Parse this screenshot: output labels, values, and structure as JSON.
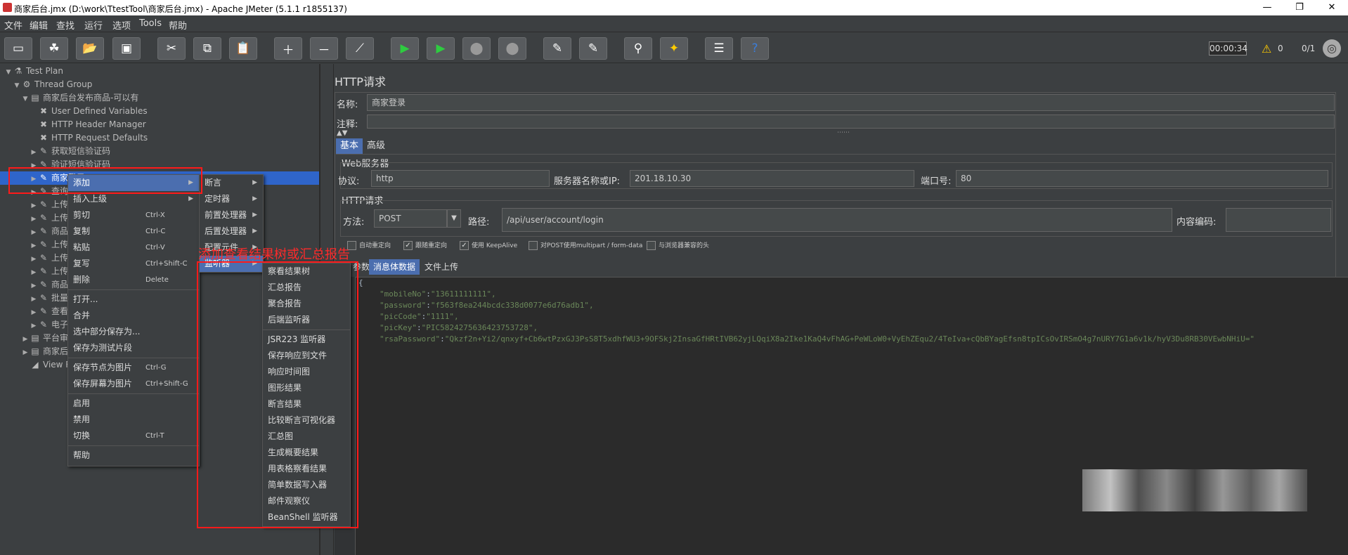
{
  "titlebar": {
    "title": "商家后台.jmx (D:\\work\\TtestTool\\商家后台.jmx) - Apache JMeter (5.1.1 r1855137)",
    "min": "—",
    "max": "❐",
    "close": "✕"
  },
  "menubar": {
    "items": [
      "文件",
      "编辑",
      "查找",
      "运行",
      "选项",
      "Tools",
      "帮助"
    ]
  },
  "toolbar": {
    "timer": "00:00:34",
    "warnings": "0",
    "threads": "0/1",
    "buttons": [
      "new-icon",
      "templates-icon",
      "open-icon",
      "save-icon",
      "cut-icon",
      "copy-icon",
      "paste-icon",
      "expand-icon",
      "collapse-icon",
      "toggle-icon",
      "start-icon",
      "start-no-pause-icon",
      "stop-icon",
      "shutdown-icon",
      "clear-icon",
      "clear-all-icon",
      "search-icon",
      "reset-search-icon",
      "function-helper-icon",
      "help-icon"
    ]
  },
  "tree": {
    "items": [
      {
        "label": "Test Plan",
        "indent": 0,
        "arrow": "▼",
        "icon": "⚗"
      },
      {
        "label": "Thread Group",
        "indent": 1,
        "arrow": "▼",
        "icon": "⚙"
      },
      {
        "label": "商家后台发布商品-可以有",
        "indent": 2,
        "arrow": "▼",
        "icon": "▤"
      },
      {
        "label": "User Defined Variables",
        "indent": 3,
        "arrow": "",
        "icon": "✖"
      },
      {
        "label": "HTTP Header Manager",
        "indent": 3,
        "arrow": "",
        "icon": "✖"
      },
      {
        "label": "HTTP Request Defaults",
        "indent": 3,
        "arrow": "",
        "icon": "✖"
      },
      {
        "label": "获取短信验证码",
        "indent": 3,
        "arrow": "▶",
        "icon": "✎"
      },
      {
        "label": "验证短信验证码",
        "indent": 3,
        "arrow": "▶",
        "icon": "✎"
      },
      {
        "label": "商家登录",
        "indent": 3,
        "arrow": "▶",
        "icon": "✎",
        "selected": true
      },
      {
        "label": "查询店",
        "indent": 3,
        "arrow": "▶",
        "icon": "✎"
      },
      {
        "label": "上传商",
        "indent": 3,
        "arrow": "▶",
        "icon": "✎"
      },
      {
        "label": "上传商",
        "indent": 3,
        "arrow": "▶",
        "icon": "✎"
      },
      {
        "label": "商品发",
        "indent": 3,
        "arrow": "▶",
        "icon": "✎"
      },
      {
        "label": "上传商",
        "indent": 3,
        "arrow": "▶",
        "icon": "✎"
      },
      {
        "label": "上传商",
        "indent": 3,
        "arrow": "▶",
        "icon": "✎"
      },
      {
        "label": "上传商",
        "indent": 3,
        "arrow": "▶",
        "icon": "✎"
      },
      {
        "label": "商品发",
        "indent": 3,
        "arrow": "▶",
        "icon": "✎"
      },
      {
        "label": "批量导",
        "indent": 3,
        "arrow": "▶",
        "icon": "✎"
      },
      {
        "label": "查看导",
        "indent": 3,
        "arrow": "▶",
        "icon": "✎"
      },
      {
        "label": "电子面",
        "indent": 3,
        "arrow": "▶",
        "icon": "✎"
      },
      {
        "label": "平台审核",
        "indent": 2,
        "arrow": "▶",
        "icon": "▤"
      },
      {
        "label": "商家后台",
        "indent": 2,
        "arrow": "▶",
        "icon": "▤"
      },
      {
        "label": "View Re",
        "indent": 2,
        "arrow": "",
        "icon": "◢"
      }
    ]
  },
  "panel": {
    "heading": "HTTP请求",
    "name_label": "名称:",
    "name_value": "商家登录",
    "comment_label": "注释:",
    "tabs": [
      "基本",
      "高级"
    ],
    "web_server_legend": "Web服务器",
    "protocol_label": "协议:",
    "protocol_value": "http",
    "server_label": "服务器名称或IP:",
    "server_value": "201.18.10.30",
    "port_label": "端口号:",
    "port_value": "80",
    "http_request_legend": "HTTP请求",
    "method_label": "方法:",
    "method_value": "POST",
    "path_label": "路径:",
    "path_value": "/api/user/account/login",
    "encoding_label": "内容编码:",
    "checkboxes": [
      {
        "label": "自动重定向",
        "checked": false
      },
      {
        "label": "跟随重定向",
        "checked": true
      },
      {
        "label": "使用 KeepAlive",
        "checked": true
      },
      {
        "label": "对POST使用multipart / form-data",
        "checked": false
      },
      {
        "label": "与浏览器兼容的头",
        "checked": false
      }
    ],
    "body_tabs": [
      "参数",
      "消息体数据",
      "文件上传"
    ],
    "body_lines": [
      {
        "key": "\"mobileNo\"",
        "val": "\"13611111111\","
      },
      {
        "key": "\"password\"",
        "val": "\"f563f8ea244bcdc338d0077e6d76adb1\","
      },
      {
        "key": "\"picCode\"",
        "val": "\"1111\","
      },
      {
        "key": "\"picKey\"",
        "val": "\"PIC5824275636423753728\","
      },
      {
        "key": "\"rsaPassword\"",
        "val": "\"Qkzf2n+Yi2/qnxyf+Cb6wtPzxGJ3PsS8T5xdhfWU3+9OFSkj2InsaGfHRtIVB62yjLQqiX8a2Ike1KaQ4vFhAG+PeWLoW0+VyEhZEqu2/4TeIva+cQbBYagEfsn8tpICsOvIRSmO4g7nURY7G1a6v1k/hyV3Du8RB30VEwbNHiU=\""
      }
    ]
  },
  "context_menu": {
    "items": [
      {
        "label": "添加",
        "shortcut": "",
        "submenu": true,
        "highlight": true
      },
      {
        "label": "插入上级",
        "shortcut": "",
        "submenu": true
      },
      {
        "label": "剪切",
        "shortcut": "Ctrl-X"
      },
      {
        "label": "复制",
        "shortcut": "Ctrl-C"
      },
      {
        "label": "粘贴",
        "shortcut": "Ctrl-V"
      },
      {
        "label": "复写",
        "shortcut": "Ctrl+Shift-C"
      },
      {
        "label": "删除",
        "shortcut": "Delete"
      },
      {
        "sep": true
      },
      {
        "label": "打开...",
        "shortcut": ""
      },
      {
        "label": "合并",
        "shortcut": ""
      },
      {
        "label": "选中部分保存为...",
        "shortcut": ""
      },
      {
        "label": "保存为测试片段",
        "shortcut": ""
      },
      {
        "sep": true
      },
      {
        "label": "保存节点为图片",
        "shortcut": "Ctrl-G"
      },
      {
        "label": "保存屏幕为图片",
        "shortcut": "Ctrl+Shift-G"
      },
      {
        "sep": true
      },
      {
        "label": "启用",
        "shortcut": ""
      },
      {
        "label": "禁用",
        "shortcut": ""
      },
      {
        "label": "切换",
        "shortcut": "Ctrl-T"
      },
      {
        "sep": true
      },
      {
        "label": "帮助",
        "shortcut": ""
      }
    ]
  },
  "add_menu": {
    "items": [
      "断言",
      "定时器",
      "前置处理器",
      "后置处理器",
      "配置元件",
      "监听器"
    ]
  },
  "listener_menu": {
    "items": [
      "察看结果树",
      "汇总报告",
      "聚合报告",
      "后端监听器",
      "JSR223 监听器",
      "保存响应到文件",
      "响应时间图",
      "图形结果",
      "断言结果",
      "比较断言可视化器",
      "汇总图",
      "生成概要结果",
      "用表格察看结果",
      "简单数据写入器",
      "邮件观察仪",
      "BeanShell 监听器"
    ]
  },
  "annotation": "添加查看结果树或汇总报告"
}
